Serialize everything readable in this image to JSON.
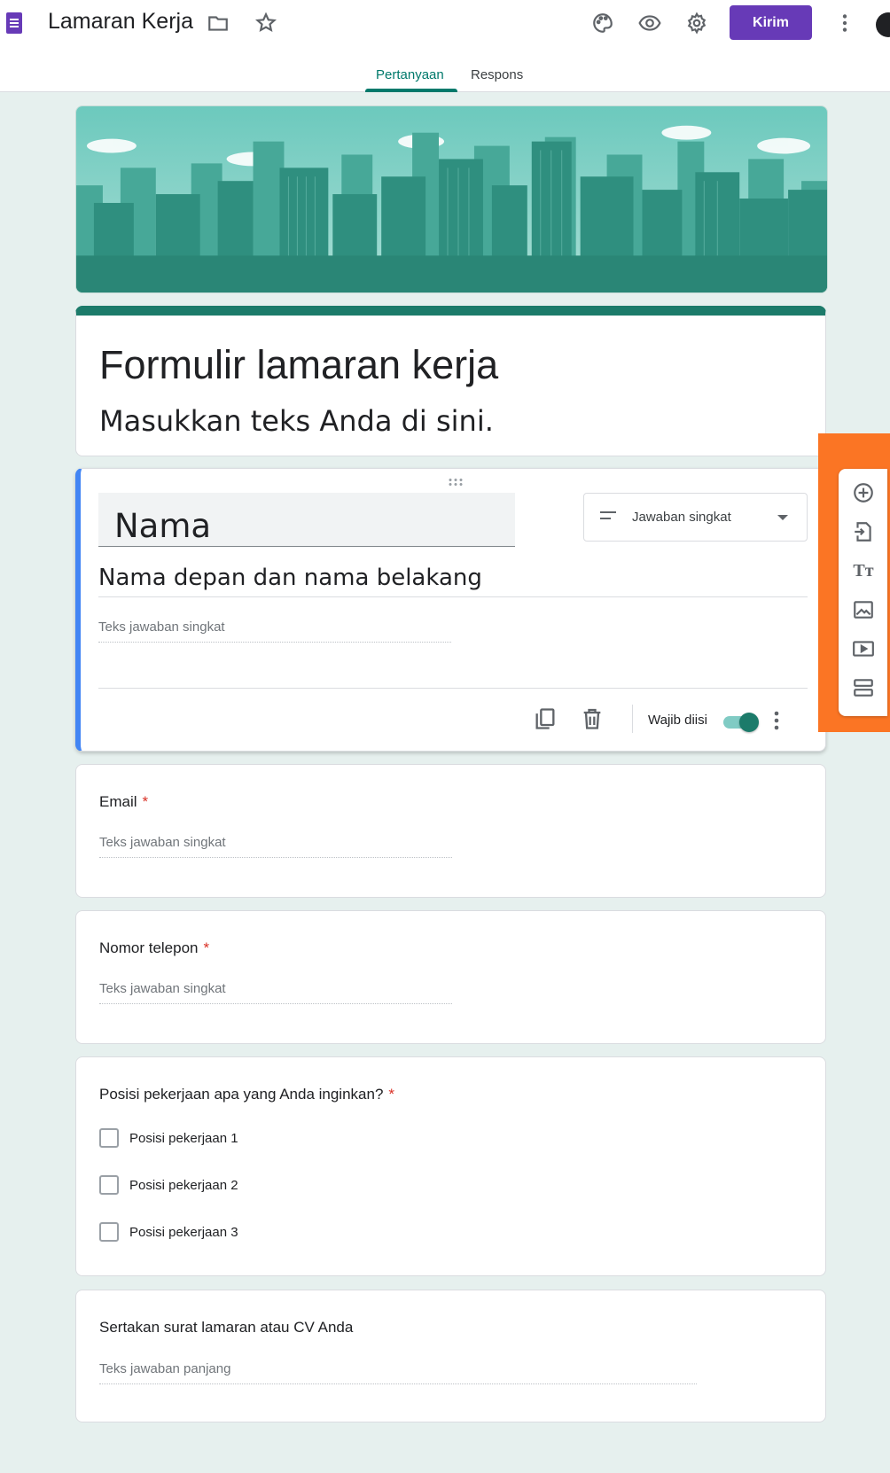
{
  "header": {
    "form_name": "Lamaran Kerja",
    "send_label": "Kirim",
    "brand_color": "#673ab7",
    "icons": [
      "forms-logo-icon",
      "folder-icon",
      "star-icon",
      "palette-icon",
      "eye-icon",
      "gear-icon",
      "more-vert-icon"
    ]
  },
  "tabs": [
    {
      "label": "Pertanyaan",
      "active": true
    },
    {
      "label": "Respons",
      "active": false
    }
  ],
  "form": {
    "title": "Formulir lamaran kerja",
    "description": "Masukkan teks Anda di sini.",
    "theme_color": "#1c7b6a"
  },
  "active_question": {
    "title": "Nama",
    "type_label": "Jawaban singkat",
    "description": "Nama depan dan nama belakang",
    "answer_placeholder": "Teks jawaban singkat",
    "required_label": "Wajib diisi",
    "required": true
  },
  "questions": [
    {
      "label": "Email",
      "required": "*",
      "answer_placeholder": "Teks jawaban singkat"
    },
    {
      "label": "Nomor telepon",
      "required": "*",
      "answer_placeholder": "Teks jawaban singkat"
    },
    {
      "label": "Posisi pekerjaan apa yang Anda inginkan?",
      "required": "*",
      "options": [
        "Posisi pekerjaan 1",
        "Posisi pekerjaan 2",
        "Posisi pekerjaan 3"
      ]
    },
    {
      "label": "Sertakan surat lamaran atau CV Anda",
      "answer_placeholder": "Teks jawaban panjang"
    }
  ],
  "side_toolbar": {
    "tools": [
      "add-question-icon",
      "import-questions-icon",
      "add-title-icon",
      "add-image-icon",
      "add-video-icon",
      "add-section-icon"
    ],
    "title_glyph": "Tт",
    "highlight_color": "#fb7524"
  }
}
